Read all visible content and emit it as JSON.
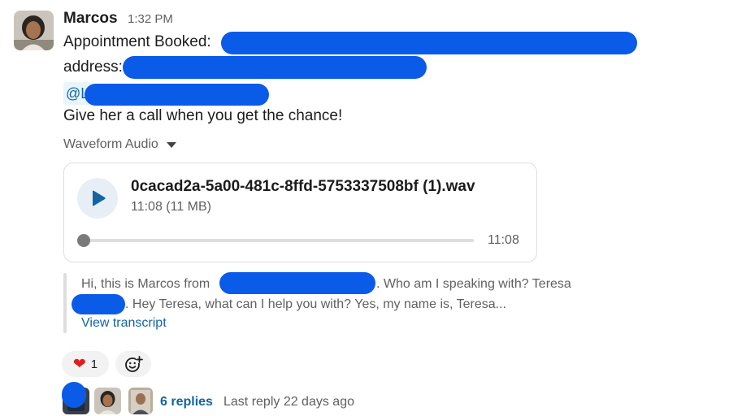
{
  "message": {
    "author": "Marcos",
    "time": "1:32 PM",
    "line1_prefix": "Appointment Booked:",
    "line2_prefix": "address:",
    "mention_prefix": "@L",
    "line4": "Give her a call when you get the chance!"
  },
  "attachment": {
    "section_label": "Waveform Audio",
    "filename": "0cacad2a-5a00-481c-8ffd-5753337508bf (1).wav",
    "meta": "11:08 (11 MB)",
    "duration": "11:08",
    "progress": 0
  },
  "transcript": {
    "part1": "Hi, this is Marcos from",
    "part2": ". Who am I speaking with? Teresa",
    "part3": ". Hey Teresa, what can I help you with? Yes, my name is, Teresa...",
    "link": "View transcript"
  },
  "reactions": {
    "heart_count": "1"
  },
  "thread": {
    "replies": "6 replies",
    "last_reply": "Last reply 22 days ago"
  },
  "colors": {
    "link": "#1264a3",
    "redaction": "#0a5be8",
    "muted": "#616061"
  }
}
